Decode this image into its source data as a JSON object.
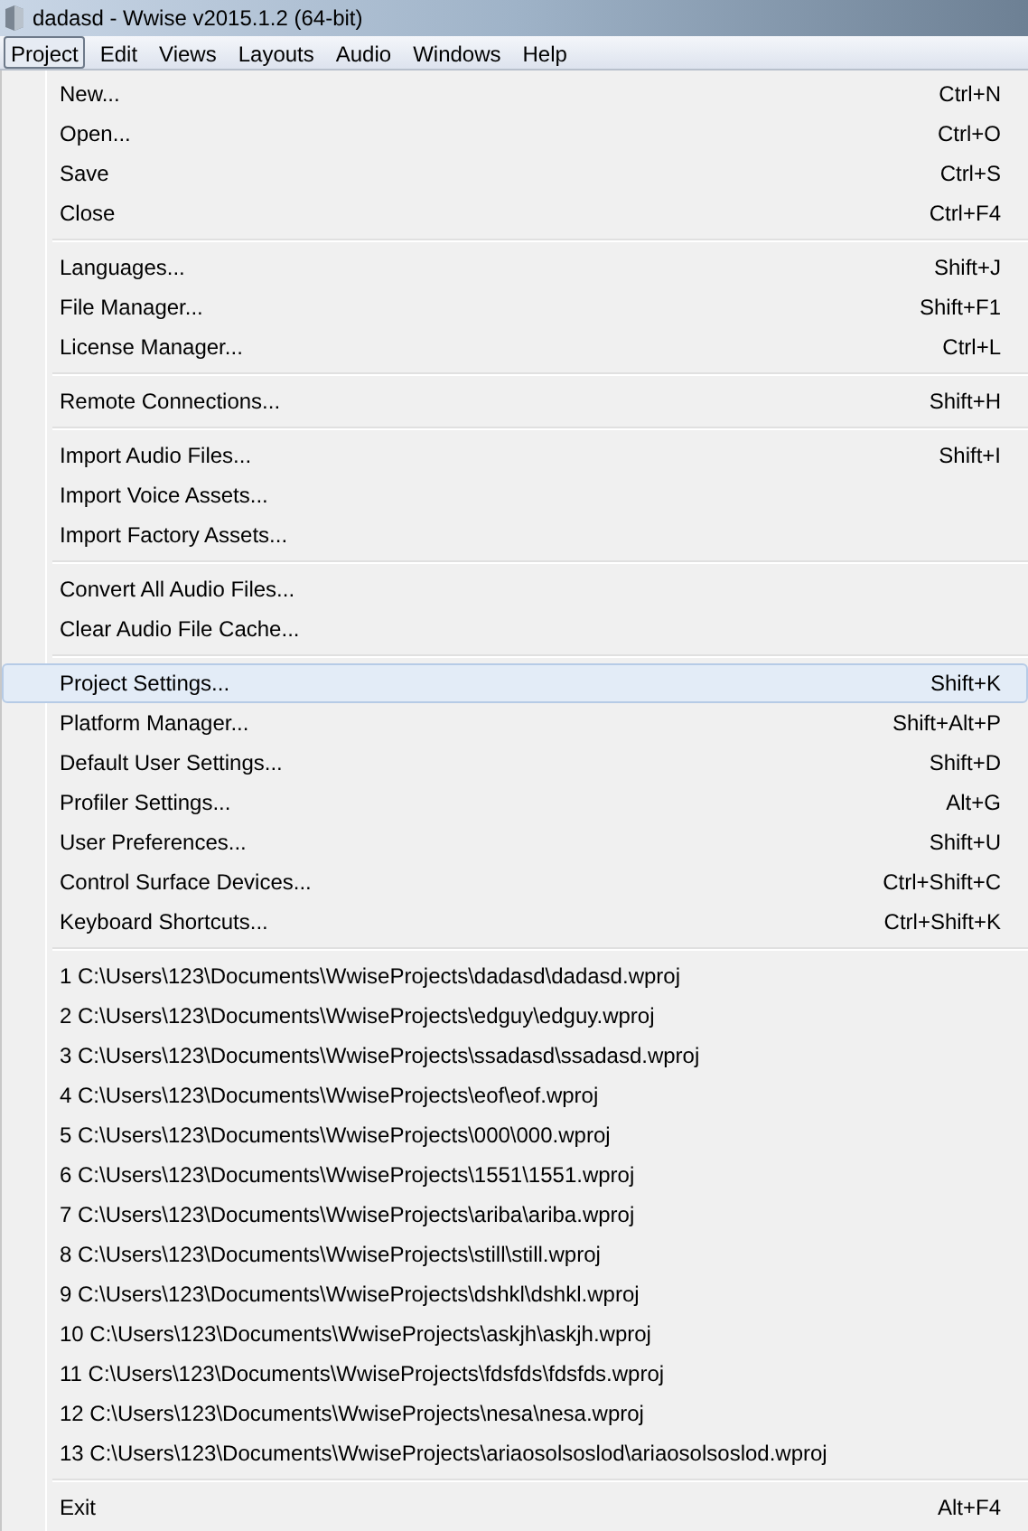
{
  "window": {
    "title": "dadasd - Wwise v2015.1.2 (64-bit)"
  },
  "menu_bar": [
    {
      "label": "Project",
      "selected": true
    },
    {
      "label": "Edit",
      "selected": false
    },
    {
      "label": "Views",
      "selected": false
    },
    {
      "label": "Layouts",
      "selected": false
    },
    {
      "label": "Audio",
      "selected": false
    },
    {
      "label": "Windows",
      "selected": false
    },
    {
      "label": "Help",
      "selected": false
    }
  ],
  "menu_groups": [
    [
      {
        "label": "New...",
        "shortcut": "Ctrl+N",
        "selected": false
      },
      {
        "label": "Open...",
        "shortcut": "Ctrl+O",
        "selected": false
      },
      {
        "label": "Save",
        "shortcut": "Ctrl+S",
        "selected": false
      },
      {
        "label": "Close",
        "shortcut": "Ctrl+F4",
        "selected": false
      }
    ],
    [
      {
        "label": "Languages...",
        "shortcut": "Shift+J",
        "selected": false
      },
      {
        "label": "File Manager...",
        "shortcut": "Shift+F1",
        "selected": false
      },
      {
        "label": "License Manager...",
        "shortcut": "Ctrl+L",
        "selected": false
      }
    ],
    [
      {
        "label": "Remote Connections...",
        "shortcut": "Shift+H",
        "selected": false
      }
    ],
    [
      {
        "label": "Import Audio Files...",
        "shortcut": "Shift+I",
        "selected": false
      },
      {
        "label": "Import Voice Assets...",
        "selected": false
      },
      {
        "label": "Import Factory Assets...",
        "selected": false
      }
    ],
    [
      {
        "label": "Convert All Audio Files...",
        "selected": false
      },
      {
        "label": "Clear Audio File Cache...",
        "selected": false
      }
    ],
    [
      {
        "label": "Project Settings...",
        "shortcut": "Shift+K",
        "selected": true
      },
      {
        "label": "Platform Manager...",
        "shortcut": "Shift+Alt+P",
        "selected": false
      },
      {
        "label": "Default User Settings...",
        "shortcut": "Shift+D",
        "selected": false
      },
      {
        "label": "Profiler Settings...",
        "shortcut": "Alt+G",
        "selected": false
      },
      {
        "label": "User Preferences...",
        "shortcut": "Shift+U",
        "selected": false
      },
      {
        "label": "Control Surface Devices...",
        "shortcut": "Ctrl+Shift+C",
        "selected": false
      },
      {
        "label": "Keyboard Shortcuts...",
        "shortcut": "Ctrl+Shift+K",
        "selected": false
      }
    ],
    [
      {
        "label": "1 C:\\Users\\123\\Documents\\WwiseProjects\\dadasd\\dadasd.wproj",
        "selected": false
      },
      {
        "label": "2 C:\\Users\\123\\Documents\\WwiseProjects\\edguy\\edguy.wproj",
        "selected": false
      },
      {
        "label": "3 C:\\Users\\123\\Documents\\WwiseProjects\\ssadasd\\ssadasd.wproj",
        "selected": false
      },
      {
        "label": "4 C:\\Users\\123\\Documents\\WwiseProjects\\eof\\eof.wproj",
        "selected": false
      },
      {
        "label": "5 C:\\Users\\123\\Documents\\WwiseProjects\\000\\000.wproj",
        "selected": false
      },
      {
        "label": "6 C:\\Users\\123\\Documents\\WwiseProjects\\1551\\1551.wproj",
        "selected": false
      },
      {
        "label": "7 C:\\Users\\123\\Documents\\WwiseProjects\\ariba\\ariba.wproj",
        "selected": false
      },
      {
        "label": "8 C:\\Users\\123\\Documents\\WwiseProjects\\still\\still.wproj",
        "selected": false
      },
      {
        "label": "9 C:\\Users\\123\\Documents\\WwiseProjects\\dshkl\\dshkl.wproj",
        "selected": false
      },
      {
        "label": "10 C:\\Users\\123\\Documents\\WwiseProjects\\askjh\\askjh.wproj",
        "selected": false
      },
      {
        "label": "11 C:\\Users\\123\\Documents\\WwiseProjects\\fdsfds\\fdsfds.wproj",
        "selected": false
      },
      {
        "label": "12 C:\\Users\\123\\Documents\\WwiseProjects\\nesa\\nesa.wproj",
        "selected": false
      },
      {
        "label": "13 C:\\Users\\123\\Documents\\WwiseProjects\\ariaosolsoslod\\ariaosolsoslod.wproj",
        "selected": false
      }
    ],
    [
      {
        "label": "Exit",
        "shortcut": "Alt+F4",
        "selected": false
      }
    ]
  ]
}
